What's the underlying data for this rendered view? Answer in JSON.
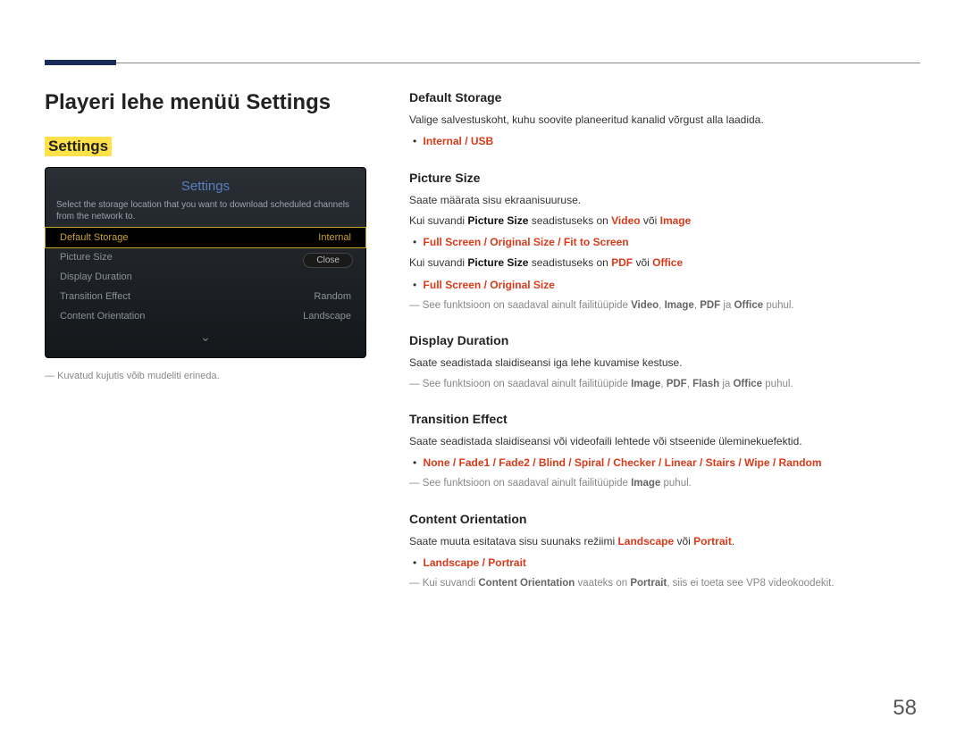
{
  "page": {
    "number": "58"
  },
  "left": {
    "title": "Playeri lehe menüü Settings",
    "highlight": "Settings",
    "panel": {
      "title": "Settings",
      "help": "Select the storage location that you want to download scheduled channels from the network to.",
      "rows": [
        {
          "label": "Default Storage",
          "value": "Internal",
          "selected": true
        },
        {
          "label": "Picture Size",
          "value": ""
        },
        {
          "label": "Display Duration",
          "value": ""
        },
        {
          "label": "Transition Effect",
          "value": "Random"
        },
        {
          "label": "Content Orientation",
          "value": "Landscape"
        }
      ],
      "close": "Close"
    },
    "caption": "Kuvatud kujutis võib mudeliti erineda."
  },
  "right": {
    "s1": {
      "h": "Default Storage",
      "p1": "Valige salvestuskoht, kuhu soovite planeeritud kanalid võrgust alla laadida.",
      "opt": "Internal / USB"
    },
    "s2": {
      "h": "Picture Size",
      "p1": "Saate määrata sisu ekraanisuuruse.",
      "p2a": "Kui suvandi ",
      "p2b": "Picture Size",
      "p2c": " seadistuseks on ",
      "p2d": "Video",
      "p2e": " või ",
      "p2f": "Image",
      "opt1": "Full Screen / Original Size / Fit to Screen",
      "p3a": "Kui suvandi ",
      "p3b": "Picture Size",
      "p3c": " seadistuseks on ",
      "p3d": "PDF",
      "p3e": " või ",
      "p3f": "Office",
      "opt2": "Full Screen / Original Size",
      "n1a": "See funktsioon on saadaval ainult failitüüpide ",
      "n1b": "Video",
      "n1c": ", ",
      "n1d": "Image",
      "n1e": ", ",
      "n1f": "PDF",
      "n1g": " ja ",
      "n1h": "Office",
      "n1i": " puhul."
    },
    "s3": {
      "h": "Display Duration",
      "p1": "Saate seadistada slaidiseansi iga lehe kuvamise kestuse.",
      "n1a": "See funktsioon on saadaval ainult failitüüpide ",
      "n1b": "Image",
      "n1c": ", ",
      "n1d": "PDF",
      "n1e": ", ",
      "n1f": "Flash",
      "n1g": " ja ",
      "n1h": "Office",
      "n1i": " puhul."
    },
    "s4": {
      "h": "Transition Effect",
      "p1": "Saate seadistada slaidiseansi või videofaili lehtede või stseenide üleminekuefektid.",
      "opt": "None / Fade1 / Fade2 / Blind / Spiral / Checker / Linear / Stairs / Wipe / Random",
      "n1a": "See funktsioon on saadaval ainult failitüüpide ",
      "n1b": "Image",
      "n1c": " puhul."
    },
    "s5": {
      "h": "Content Orientation",
      "p1a": "Saate muuta esitatava sisu suunaks režiimi ",
      "p1b": "Landscape",
      "p1c": " või ",
      "p1d": "Portrait",
      "p1e": ".",
      "opt": "Landscape / Portrait",
      "n1a": "Kui suvandi ",
      "n1b": "Content Orientation",
      "n1c": " vaateks on ",
      "n1d": "Portrait",
      "n1e": ", siis ei toeta see VP8 videokoodekit."
    }
  }
}
